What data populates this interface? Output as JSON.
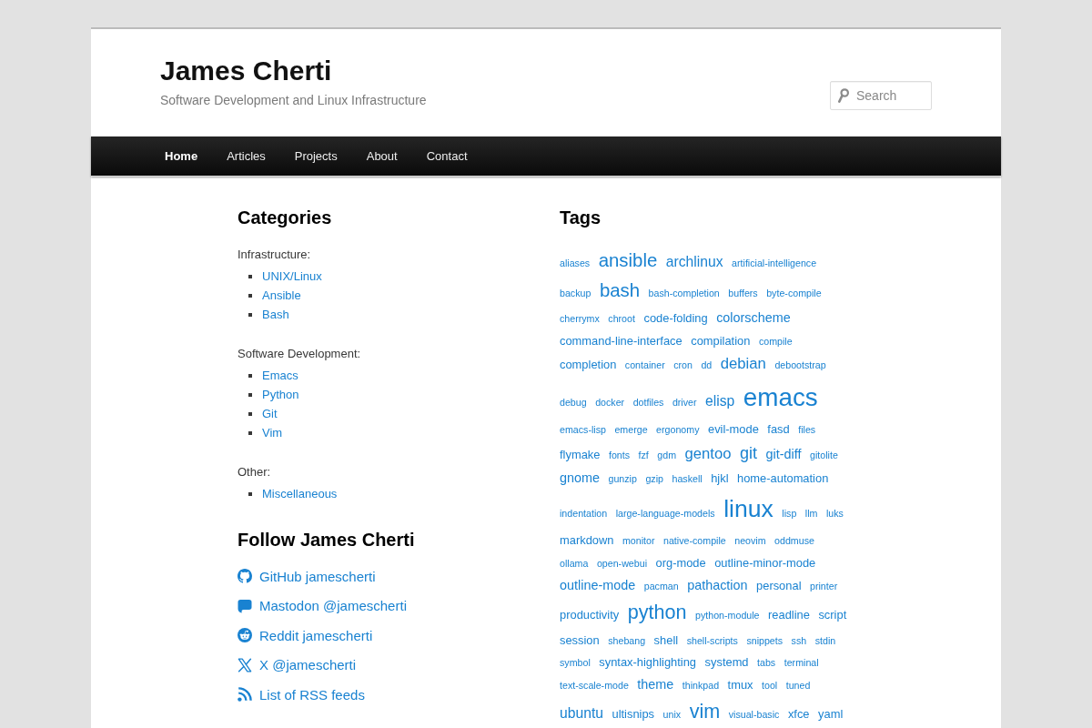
{
  "site": {
    "title": "James Cherti",
    "tagline": "Software Development and Linux Infrastructure"
  },
  "search": {
    "placeholder": "Search"
  },
  "nav": [
    {
      "label": "Home",
      "selected": true
    },
    {
      "label": "Articles",
      "selected": false
    },
    {
      "label": "Projects",
      "selected": false
    },
    {
      "label": "About",
      "selected": false
    },
    {
      "label": "Contact",
      "selected": false
    }
  ],
  "categories": {
    "title": "Categories",
    "groups": [
      {
        "label": "Infrastructure:",
        "links": [
          "UNIX/Linux",
          "Ansible",
          "Bash"
        ]
      },
      {
        "label": "Software Development:",
        "links": [
          "Emacs",
          "Python",
          "Git",
          "Vim"
        ]
      },
      {
        "label": "Other:",
        "links": [
          "Miscellaneous"
        ]
      }
    ]
  },
  "follow": {
    "title": "Follow James Cherti",
    "links": [
      {
        "kind": "github",
        "label": "GitHub jamescherti"
      },
      {
        "kind": "mastodon",
        "label": "Mastodon @jamescherti"
      },
      {
        "kind": "reddit",
        "label": "Reddit jamescherti"
      },
      {
        "kind": "x",
        "label": "X @jamescherti"
      },
      {
        "kind": "rss",
        "label": "List of RSS feeds"
      }
    ]
  },
  "tags": {
    "title": "Tags",
    "items": [
      {
        "label": "aliases",
        "kind": "minor"
      },
      {
        "label": "ansible",
        "kind": "large"
      },
      {
        "label": "archlinux",
        "kind": "medium"
      },
      {
        "label": "artificial-intelligence",
        "kind": "minor"
      },
      {
        "label": "backup",
        "kind": "minor"
      },
      {
        "label": "bash",
        "kind": "large"
      },
      {
        "label": "bash-completion",
        "kind": "minor"
      },
      {
        "label": "buffers",
        "kind": "minor"
      },
      {
        "label": "byte-compile",
        "kind": "minor"
      },
      {
        "label": "cherrymx",
        "kind": "minor"
      },
      {
        "label": "chroot",
        "kind": "minor"
      },
      {
        "label": "code-folding",
        "kind": "small"
      },
      {
        "label": "colorscheme",
        "kind": "regular"
      },
      {
        "label": "command-line-interface",
        "kind": "small"
      },
      {
        "label": "compilation",
        "kind": "small"
      },
      {
        "label": "compile",
        "kind": "minor"
      },
      {
        "label": "completion",
        "kind": "small"
      },
      {
        "label": "container",
        "kind": "minor"
      },
      {
        "label": "cron",
        "kind": "minor"
      },
      {
        "label": "dd",
        "kind": "minor"
      },
      {
        "label": "debian",
        "kind": "notable"
      },
      {
        "label": "debootstrap",
        "kind": "minor"
      },
      {
        "label": "debug",
        "kind": "minor"
      },
      {
        "label": "docker",
        "kind": "minor"
      },
      {
        "label": "dotfiles",
        "kind": "minor"
      },
      {
        "label": "driver",
        "kind": "minor"
      },
      {
        "label": "elisp",
        "kind": "medium"
      },
      {
        "label": "emacs",
        "kind": "biggest"
      },
      {
        "label": "emacs-lisp",
        "kind": "minor"
      },
      {
        "label": "emerge",
        "kind": "minor"
      },
      {
        "label": "ergonomy",
        "kind": "minor"
      },
      {
        "label": "evil-mode",
        "kind": "small"
      },
      {
        "label": "fasd",
        "kind": "small"
      },
      {
        "label": "files",
        "kind": "minor"
      },
      {
        "label": "flymake",
        "kind": "small"
      },
      {
        "label": "fonts",
        "kind": "minor"
      },
      {
        "label": "fzf",
        "kind": "minor"
      },
      {
        "label": "gdm",
        "kind": "minor"
      },
      {
        "label": "gentoo",
        "kind": "notable"
      },
      {
        "label": "git",
        "kind": "big"
      },
      {
        "label": "git-diff",
        "kind": "regular"
      },
      {
        "label": "gitolite",
        "kind": "minor"
      },
      {
        "label": "gnome",
        "kind": "regular"
      },
      {
        "label": "gunzip",
        "kind": "minor"
      },
      {
        "label": "gzip",
        "kind": "minor"
      },
      {
        "label": "haskell",
        "kind": "minor"
      },
      {
        "label": "hjkl",
        "kind": "small"
      },
      {
        "label": "home-automation",
        "kind": "small"
      },
      {
        "label": "indentation",
        "kind": "minor"
      },
      {
        "label": "large-language-models",
        "kind": "minor"
      },
      {
        "label": "linux",
        "kind": "huge"
      },
      {
        "label": "lisp",
        "kind": "minor"
      },
      {
        "label": "llm",
        "kind": "minor"
      },
      {
        "label": "luks",
        "kind": "minor"
      },
      {
        "label": "markdown",
        "kind": "small"
      },
      {
        "label": "monitor",
        "kind": "minor"
      },
      {
        "label": "native-compile",
        "kind": "minor"
      },
      {
        "label": "neovim",
        "kind": "minor"
      },
      {
        "label": "oddmuse",
        "kind": "minor"
      },
      {
        "label": "ollama",
        "kind": "minor"
      },
      {
        "label": "open-webui",
        "kind": "minor"
      },
      {
        "label": "org-mode",
        "kind": "small"
      },
      {
        "label": "outline-minor-mode",
        "kind": "small"
      },
      {
        "label": "outline-mode",
        "kind": "regular"
      },
      {
        "label": "pacman",
        "kind": "minor"
      },
      {
        "label": "pathaction",
        "kind": "regular"
      },
      {
        "label": "personal",
        "kind": "small"
      },
      {
        "label": "printer",
        "kind": "minor"
      },
      {
        "label": "productivity",
        "kind": "small"
      },
      {
        "label": "python",
        "kind": "major"
      },
      {
        "label": "python-module",
        "kind": "minor"
      },
      {
        "label": "readline",
        "kind": "small"
      },
      {
        "label": "script",
        "kind": "small"
      },
      {
        "label": "session",
        "kind": "small"
      },
      {
        "label": "shebang",
        "kind": "minor"
      },
      {
        "label": "shell",
        "kind": "small"
      },
      {
        "label": "shell-scripts",
        "kind": "minor"
      },
      {
        "label": "snippets",
        "kind": "minor"
      },
      {
        "label": "ssh",
        "kind": "minor"
      },
      {
        "label": "stdin",
        "kind": "minor"
      },
      {
        "label": "symbol",
        "kind": "minor"
      },
      {
        "label": "syntax-highlighting",
        "kind": "small"
      },
      {
        "label": "systemd",
        "kind": "small"
      },
      {
        "label": "tabs",
        "kind": "minor"
      },
      {
        "label": "terminal",
        "kind": "minor"
      },
      {
        "label": "text-scale-mode",
        "kind": "minor"
      },
      {
        "label": "theme",
        "kind": "regular"
      },
      {
        "label": "thinkpad",
        "kind": "minor"
      },
      {
        "label": "tmux",
        "kind": "small"
      },
      {
        "label": "tool",
        "kind": "minor"
      },
      {
        "label": "tuned",
        "kind": "minor"
      },
      {
        "label": "ubuntu",
        "kind": "medium"
      },
      {
        "label": "ultisnips",
        "kind": "small"
      },
      {
        "label": "unix",
        "kind": "minor"
      },
      {
        "label": "vim",
        "kind": "major"
      },
      {
        "label": "visual-basic",
        "kind": "minor"
      },
      {
        "label": "xfce",
        "kind": "small"
      },
      {
        "label": "yaml",
        "kind": "small"
      }
    ]
  }
}
